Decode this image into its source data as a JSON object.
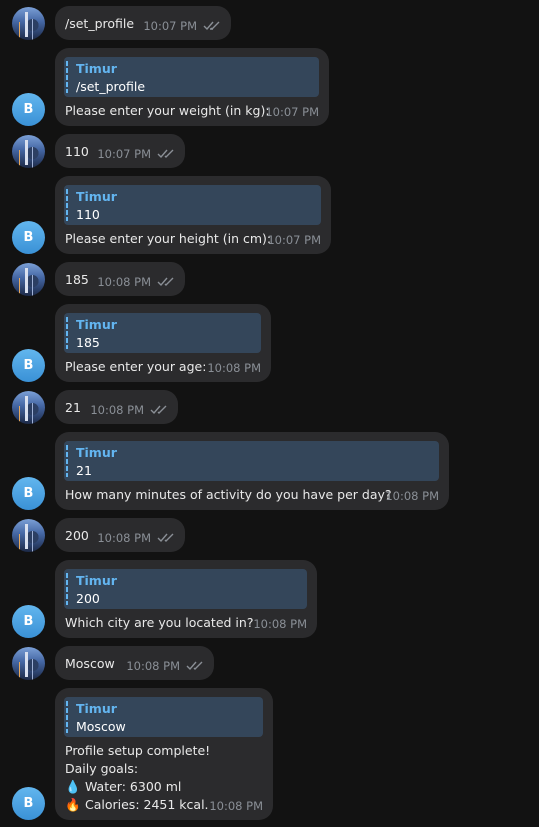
{
  "messages": [
    {
      "from": "user",
      "text": "/set_profile",
      "time": "10:07 PM"
    },
    {
      "from": "bot",
      "reply_name": "Timur",
      "reply_text": "/set_profile",
      "text": "Please enter your weight (in kg):",
      "time": "10:07 PM"
    },
    {
      "from": "user",
      "text": "110",
      "time": "10:07 PM"
    },
    {
      "from": "bot",
      "reply_name": "Timur",
      "reply_text": "110",
      "text": "Please enter your height (in cm):",
      "time": "10:07 PM"
    },
    {
      "from": "user",
      "text": "185",
      "time": "10:08 PM"
    },
    {
      "from": "bot",
      "reply_name": "Timur",
      "reply_text": "185",
      "text": "Please enter your age:",
      "time": "10:08 PM"
    },
    {
      "from": "user",
      "text": "21",
      "time": "10:08 PM"
    },
    {
      "from": "bot",
      "reply_name": "Timur",
      "reply_text": "21",
      "text": "How many minutes of activity do you have per day?",
      "time": "10:08 PM"
    },
    {
      "from": "user",
      "text": "200",
      "time": "10:08 PM"
    },
    {
      "from": "bot",
      "reply_name": "Timur",
      "reply_text": "200",
      "text": "Which city are you located in?",
      "time": "10:08 PM"
    },
    {
      "from": "user",
      "text": "Moscow",
      "time": "10:08 PM"
    },
    {
      "from": "bot",
      "reply_name": "Timur",
      "reply_text": "Moscow",
      "lines": [
        "Profile setup complete!",
        "Daily goals:",
        "Water: 6300 ml",
        "Calories: 2451 kcal."
      ],
      "time": "10:08 PM"
    }
  ],
  "bot_avatar_letter": "B",
  "icons": {
    "water": "💧",
    "calories": "🔥",
    "read": "double-check-icon"
  },
  "colors": {
    "background": "#121212",
    "bubble": "#2b2b2d",
    "reply_bg": "#34465a",
    "accent": "#63b5f0",
    "meta": "#8a8f96"
  }
}
